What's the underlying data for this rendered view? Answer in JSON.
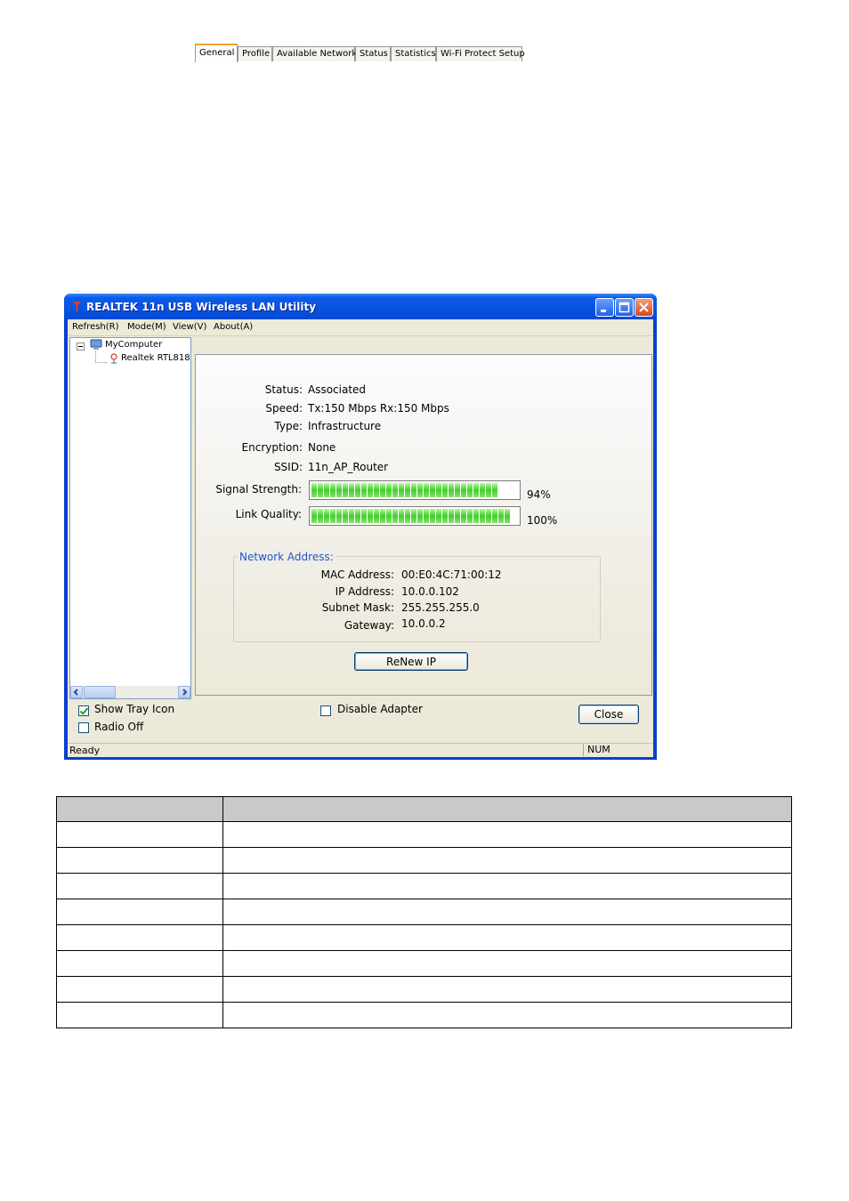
{
  "window": {
    "title": "REALTEK 11n USB Wireless LAN Utility",
    "colors": {
      "titlebar": "#0653e0",
      "client": "#ece9d8",
      "signal_bar": "#3fcf2f",
      "group_title": "#2255cc",
      "active_tab_accent": "#f6a32b"
    }
  },
  "menu": {
    "items": [
      "Refresh(R)",
      "Mode(M)",
      "View(V)",
      "About(A)"
    ]
  },
  "tree": {
    "root": "MyComputer",
    "child": "Realtek RTL818"
  },
  "tabs": [
    "General",
    "Profile",
    "Available Network",
    "Status",
    "Statistics",
    "Wi-Fi Protect Setup"
  ],
  "active_tab": "General",
  "general": {
    "status_label": "Status:",
    "status_value": "Associated",
    "speed_label": "Speed:",
    "speed_value": "Tx:150 Mbps Rx:150 Mbps",
    "type_label": "Type:",
    "type_value": "Infrastructure",
    "encryption_label": "Encryption:",
    "encryption_value": "None",
    "ssid_label": "SSID:",
    "ssid_value": "11n_AP_Router",
    "signal_label": "Signal Strength:",
    "signal_percent": 94,
    "signal_text": "94%",
    "link_label": "Link Quality:",
    "link_percent": 100,
    "link_text": "100%"
  },
  "network_address": {
    "title": "Network Address:",
    "mac_label": "MAC Address:",
    "mac_value": "00:E0:4C:71:00:12",
    "ip_label": "IP Address:",
    "ip_value": "10.0.0.102",
    "subnet_label": "Subnet Mask:",
    "subnet_value": "255.255.255.0",
    "gateway_label": "Gateway:",
    "gateway_value": "10.0.0.2"
  },
  "buttons": {
    "renew": "ReNew IP",
    "close": "Close"
  },
  "checkboxes": {
    "show_tray_label": "Show Tray Icon",
    "show_tray_checked": true,
    "radio_off_label": "Radio Off",
    "radio_off_checked": false,
    "disable_adapter_label": "Disable Adapter",
    "disable_adapter_checked": false
  },
  "statusbar": {
    "text": "Ready",
    "num": "NUM"
  },
  "doc_table": {
    "rows": 8
  }
}
